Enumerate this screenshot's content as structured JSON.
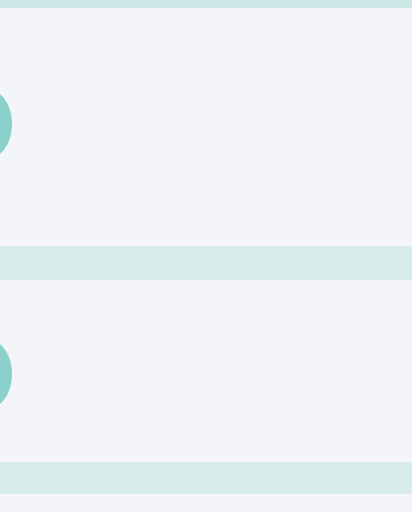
{
  "records": [
    {
      "left": {
        "heading": "",
        "lines": [
          "",
          "",
          "",
          "",
          ""
        ]
      },
      "right": {
        "heading": "",
        "lines": [
          "",
          "",
          "",
          ""
        ]
      }
    },
    {
      "left": {
        "heading": "",
        "lines": [
          "",
          "",
          ""
        ]
      },
      "right": {
        "heading": "",
        "lines": [
          "",
          "",
          ""
        ]
      }
    }
  ]
}
